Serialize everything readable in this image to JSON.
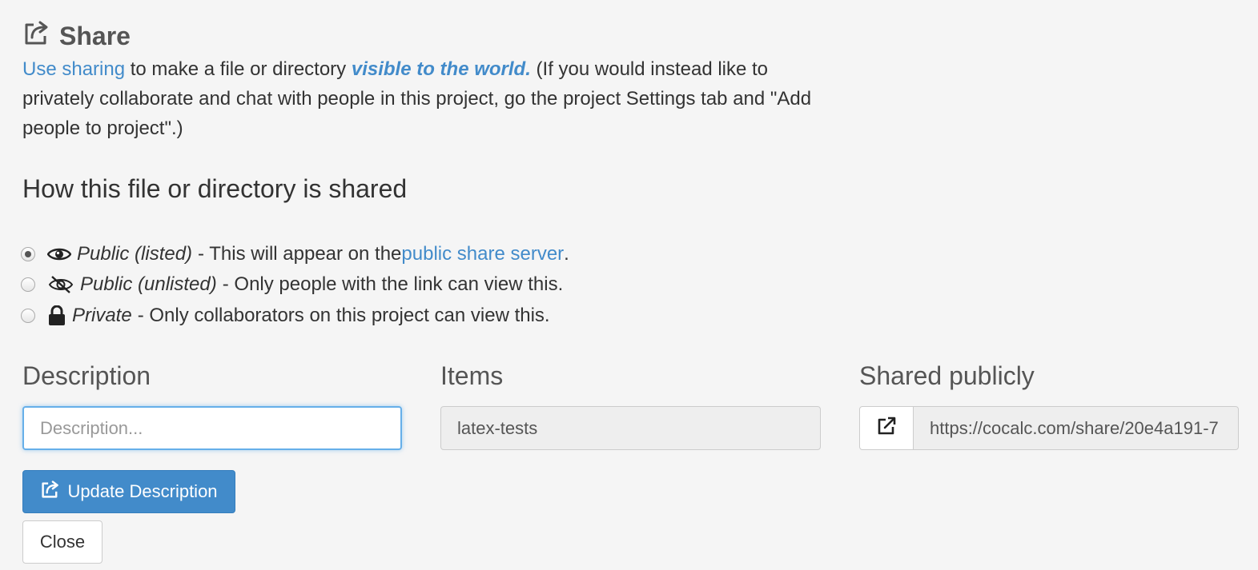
{
  "header": {
    "title": "Share",
    "icon": "share-square-icon"
  },
  "intro": {
    "link_text": "Use sharing",
    "text1": " to make a file or directory ",
    "emphasis": "visible to the world.",
    "text2": " (If you would instead like to privately collaborate and chat with people in this project, go the project Settings tab and \"Add people to project\".)"
  },
  "section": {
    "heading": "How this file or directory is shared"
  },
  "options": [
    {
      "label": "Public (listed)",
      "text": "- This will appear on the ",
      "link": "public share server",
      "suffix": ".",
      "icon": "eye-icon",
      "checked": true
    },
    {
      "label": "Public (unlisted)",
      "text": "- Only people with the link can view this.",
      "icon": "eye-slash-icon",
      "checked": false
    },
    {
      "label": "Private",
      "text": "- Only collaborators on this project can view this.",
      "icon": "lock-icon",
      "checked": false
    }
  ],
  "description": {
    "label": "Description",
    "placeholder": "Description...",
    "value": ""
  },
  "items": {
    "label": "Items",
    "value": "latex-tests"
  },
  "shared": {
    "label": "Shared publicly",
    "url": "https://cocalc.com/share/20e4a191-7"
  },
  "buttons": {
    "update": "Update Description",
    "close": "Close"
  },
  "colors": {
    "link": "#428bca",
    "primary": "#428bca",
    "background": "#f5f5f5"
  }
}
